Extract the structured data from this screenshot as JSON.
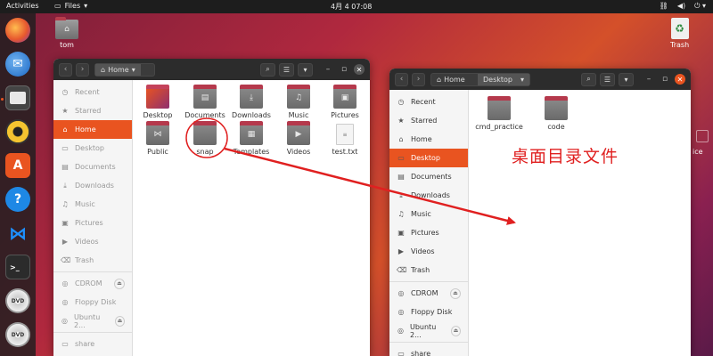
{
  "topbar": {
    "activities": "Activities",
    "files_menu": "Files",
    "clock": "4月 4 07:08"
  },
  "desktop": {
    "home_icon_label": "tom",
    "trash_label": "Trash",
    "partial_label": "ice"
  },
  "dock": {
    "items": [
      "firefox",
      "thunderbird",
      "files",
      "rhythmbox",
      "software",
      "help",
      "vscode",
      "terminal",
      "dvd",
      "dvd"
    ]
  },
  "window_home": {
    "path": "Home",
    "sidebar": [
      {
        "label": "Recent",
        "icon": "clock-icon"
      },
      {
        "label": "Starred",
        "icon": "star-icon"
      },
      {
        "label": "Home",
        "icon": "home-icon",
        "selected": true
      },
      {
        "label": "Desktop",
        "icon": "desktop-icon"
      },
      {
        "label": "Documents",
        "icon": "document-icon"
      },
      {
        "label": "Downloads",
        "icon": "download-icon"
      },
      {
        "label": "Music",
        "icon": "music-icon"
      },
      {
        "label": "Pictures",
        "icon": "picture-icon"
      },
      {
        "label": "Videos",
        "icon": "video-icon"
      },
      {
        "label": "Trash",
        "icon": "trash-icon"
      },
      {
        "label": "CDROM",
        "icon": "disc-icon",
        "eject": true
      },
      {
        "label": "Floppy Disk",
        "icon": "disc-icon"
      },
      {
        "label": "Ubuntu 2...",
        "icon": "disc-icon",
        "eject": true
      },
      {
        "label": "share",
        "icon": "folder-icon"
      }
    ],
    "files": [
      "Desktop",
      "Documents",
      "Downloads",
      "Music",
      "Pictures",
      "Public",
      "snap",
      "Templates",
      "Videos",
      "test.txt"
    ]
  },
  "window_desktop": {
    "path_home": "Home",
    "path_current": "Desktop",
    "sidebar": [
      {
        "label": "Recent",
        "icon": "clock-icon"
      },
      {
        "label": "Starred",
        "icon": "star-icon"
      },
      {
        "label": "Home",
        "icon": "home-icon"
      },
      {
        "label": "Desktop",
        "icon": "desktop-icon",
        "selected": true
      },
      {
        "label": "Documents",
        "icon": "document-icon"
      },
      {
        "label": "Downloads",
        "icon": "download-icon"
      },
      {
        "label": "Music",
        "icon": "music-icon"
      },
      {
        "label": "Pictures",
        "icon": "picture-icon"
      },
      {
        "label": "Videos",
        "icon": "video-icon"
      },
      {
        "label": "Trash",
        "icon": "trash-icon"
      },
      {
        "label": "CDROM",
        "icon": "disc-icon",
        "eject": true
      },
      {
        "label": "Floppy Disk",
        "icon": "disc-icon"
      },
      {
        "label": "Ubuntu 2...",
        "icon": "disc-icon",
        "eject": true
      },
      {
        "label": "share",
        "icon": "folder-icon"
      }
    ],
    "files": [
      "cmd_practice",
      "code"
    ]
  },
  "annotation": {
    "text": "桌面目录文件",
    "color": "#e02020"
  },
  "colors": {
    "accent": "#e95420",
    "topbar": "#1d1d1d",
    "titlebar": "#2c2c2c"
  }
}
